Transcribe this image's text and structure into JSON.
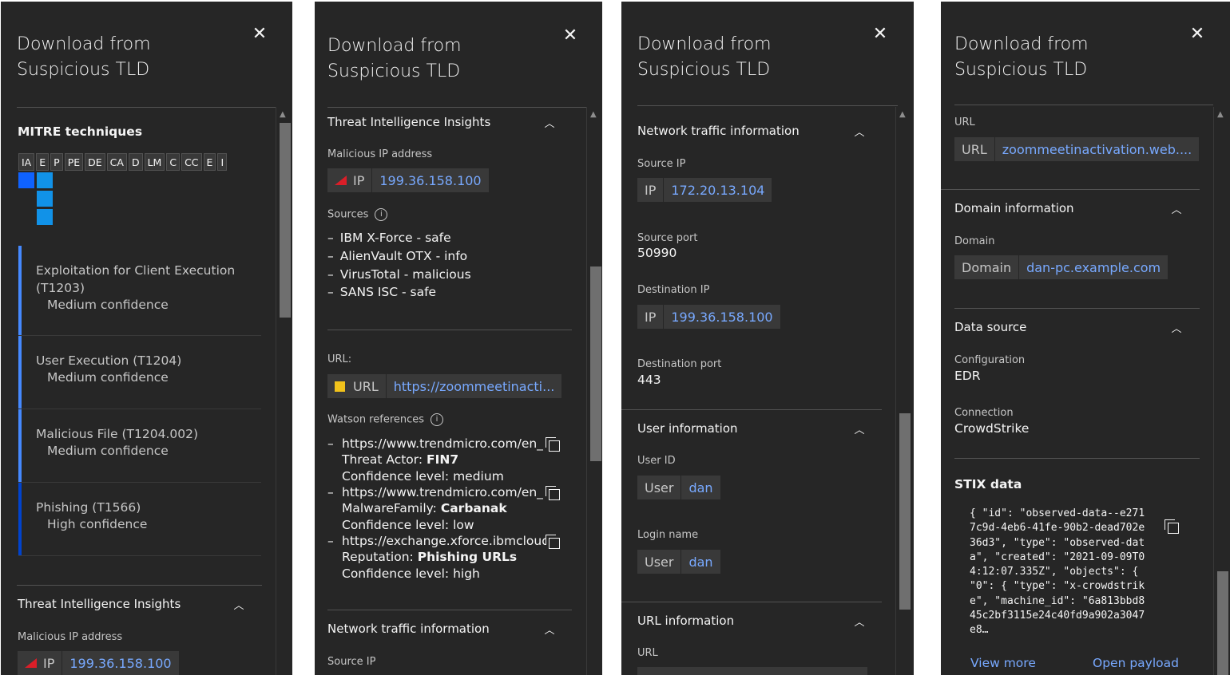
{
  "title": "Download from\nSuspicious TLD",
  "panel1": {
    "mitre_heading": "MITRE techniques",
    "mitre_tactics": [
      "IA",
      "E",
      "P",
      "PE",
      "DE",
      "CA",
      "D",
      "LM",
      "C",
      "CC",
      "E",
      "I"
    ],
    "techniques": [
      {
        "name": "Exploitation for Client Execution (T1203)",
        "confidence": "Medium confidence"
      },
      {
        "name": "User Execution (T1204)",
        "confidence": "Medium confidence"
      },
      {
        "name": "Malicious File (T1204.002)",
        "confidence": "Medium confidence"
      },
      {
        "name": "Phishing (T1566)",
        "confidence": "High confidence"
      }
    ],
    "tii_title": "Threat Intelligence Insights",
    "malicious_ip_label": "Malicious IP address",
    "ip_key": "IP",
    "ip_value": "199.36.158.100"
  },
  "panel2": {
    "tii_title": "Threat Intelligence Insights",
    "malicious_ip_label": "Malicious IP address",
    "ip_key": "IP",
    "ip_value": "199.36.158.100",
    "sources_label": "Sources",
    "sources": [
      "IBM X-Force - safe",
      "AlienVault OTX - info",
      "VirusTotal - malicious",
      "SANS ISC - safe"
    ],
    "url_label": "URL:",
    "url_key": "URL",
    "url_value": "https://zoommeetinacti...",
    "watson_label": "Watson references",
    "watson_refs": [
      {
        "url": "https://www.trendmicro.com/en_",
        "key": "Threat Actor:",
        "value": "FIN7",
        "conf": "Confidence level: medium"
      },
      {
        "url": "https://www.trendmicro.com/en_",
        "key": "MalwareFamily:",
        "value": "Carbanak",
        "conf": "Confidence level: low"
      },
      {
        "url": "https://exchange.xforce.ibmcloud",
        "key": "Reputation:",
        "value": "Phishing URLs",
        "conf": "Confidence level: high"
      }
    ],
    "network_title": "Network traffic information",
    "source_ip_label": "Source IP"
  },
  "panel3": {
    "network_title": "Network traffic information",
    "source_ip_label": "Source IP",
    "source_ip_key": "IP",
    "source_ip": "172.20.13.104",
    "source_port_label": "Source port",
    "source_port": "50990",
    "dest_ip_label": "Destination IP",
    "dest_ip_key": "IP",
    "dest_ip": "199.36.158.100",
    "dest_port_label": "Destination port",
    "dest_port": "443",
    "user_title": "User information",
    "user_id_label": "User ID",
    "user_key": "User",
    "user_id": "dan",
    "login_label": "Login name",
    "login_key": "User",
    "login_name": "dan",
    "url_info_title": "URL information",
    "url_label": "URL"
  },
  "panel4": {
    "url_label": "URL",
    "url_key": "URL",
    "url_value": "zoommeetinactivation.web....",
    "domain_title": "Domain information",
    "domain_label": "Domain",
    "domain_key": "Domain",
    "domain_value": "dan-pc.example.com",
    "ds_title": "Data source",
    "config_label": "Configuration",
    "config_value": "EDR",
    "connection_label": "Connection",
    "connection_value": "CrowdStrike",
    "stix_title": "STIX data",
    "stix_text": "{ \"id\": \"observed-data--e2717c9d-4eb6-41fe-90b2-dead702e36d3\", \"type\": \"observed-data\", \"created\": \"2021-09-09T04:12:07.335Z\", \"objects\": { \"0\": { \"type\": \"x-crowdstrike\", \"machine_id\": \"6a813bbd845c2bf3115e24c40fd9a902a3047e8…",
    "view_more": "View more",
    "open_payload": "Open payload"
  },
  "colors": {
    "panel_bg": "#262626",
    "link": "#78a9ff",
    "mitre_blue": "#1192e8",
    "mitre_dark": "#0f62fe",
    "high_bar": "#0043ce",
    "medium_bar": "#4589ff",
    "critical": "#da1e28",
    "warning": "#f1c21b"
  }
}
